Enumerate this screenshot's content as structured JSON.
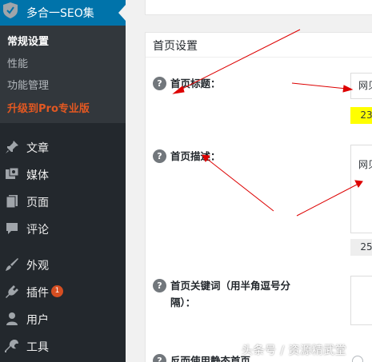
{
  "sidebar": {
    "plugin_title": "多合一SEO集",
    "submenu": [
      "常规设置",
      "性能",
      "功能管理",
      "升级到Pro专业版"
    ],
    "menu": [
      {
        "label": "文章",
        "icon": "pin-icon"
      },
      {
        "label": "媒体",
        "icon": "media-icon"
      },
      {
        "label": "页面",
        "icon": "page-icon"
      },
      {
        "label": "评论",
        "icon": "comment-icon"
      },
      {
        "label": "外观",
        "icon": "brush-icon"
      },
      {
        "label": "插件",
        "icon": "plugin-icon",
        "badge": "1"
      },
      {
        "label": "用户",
        "icon": "user-icon"
      },
      {
        "label": "工具",
        "icon": "wrench-icon"
      }
    ]
  },
  "main": {
    "box_title": "首页设置",
    "help_glyph": "?",
    "fields": {
      "title_label": "首页标题：",
      "title_value": "网贝",
      "title_counter": "23",
      "desc_label": "首页描述：",
      "desc_value": "网贝",
      "desc_counter": "25",
      "keywords_label_1": "首页关键词（用半角逗号分",
      "keywords_label_2": "隔）：",
      "static_label": "反而使用静态首页"
    }
  },
  "watermark": "头条号 / 资源精武堂",
  "colors": {
    "sidebar_bg": "#23282d",
    "submenu_bg": "#32373c",
    "header_blue": "#0073aa",
    "pro_orange": "#e25822",
    "counter_yellow": "#ffff00",
    "counter_gray": "#eeeeee",
    "arrow_red": "#dd0000"
  }
}
